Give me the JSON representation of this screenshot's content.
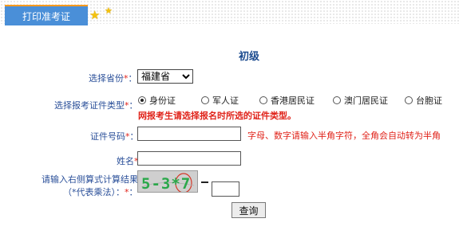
{
  "header": {
    "tab_label": "打印准考证"
  },
  "form": {
    "title": "初级",
    "required_mark": "*",
    "province": {
      "label": "选择省份",
      "selected": "福建省"
    },
    "id_type": {
      "label": "选择报考证件类型",
      "options": [
        "身份证",
        "军人证",
        "香港居民证",
        "澳门居民证",
        "台胞证"
      ],
      "selected_index": 0,
      "warning": "网报考生请选择报名时所选的证件类型。"
    },
    "id_number": {
      "label": "证件号码",
      "value": "",
      "hint": "字母、数字请输入半角字符，全角会自动转为半角"
    },
    "name": {
      "label": "姓名",
      "value": ""
    },
    "captcha": {
      "label_line1": "请输入右侧算式计算结果",
      "label_line2": "（*代表乘法）：",
      "image_text": "5-3*7",
      "answer": ""
    },
    "submit_label": "查询"
  },
  "colors": {
    "tab_bg": "#4a8fd8",
    "tab_top_border": "#ff9a1e",
    "label_blue": "#2a4f99",
    "title_blue": "#1c4b8f",
    "required_red": "#e0231a",
    "captcha_green": "#2aa84a",
    "captcha_red": "#d43a2a"
  }
}
